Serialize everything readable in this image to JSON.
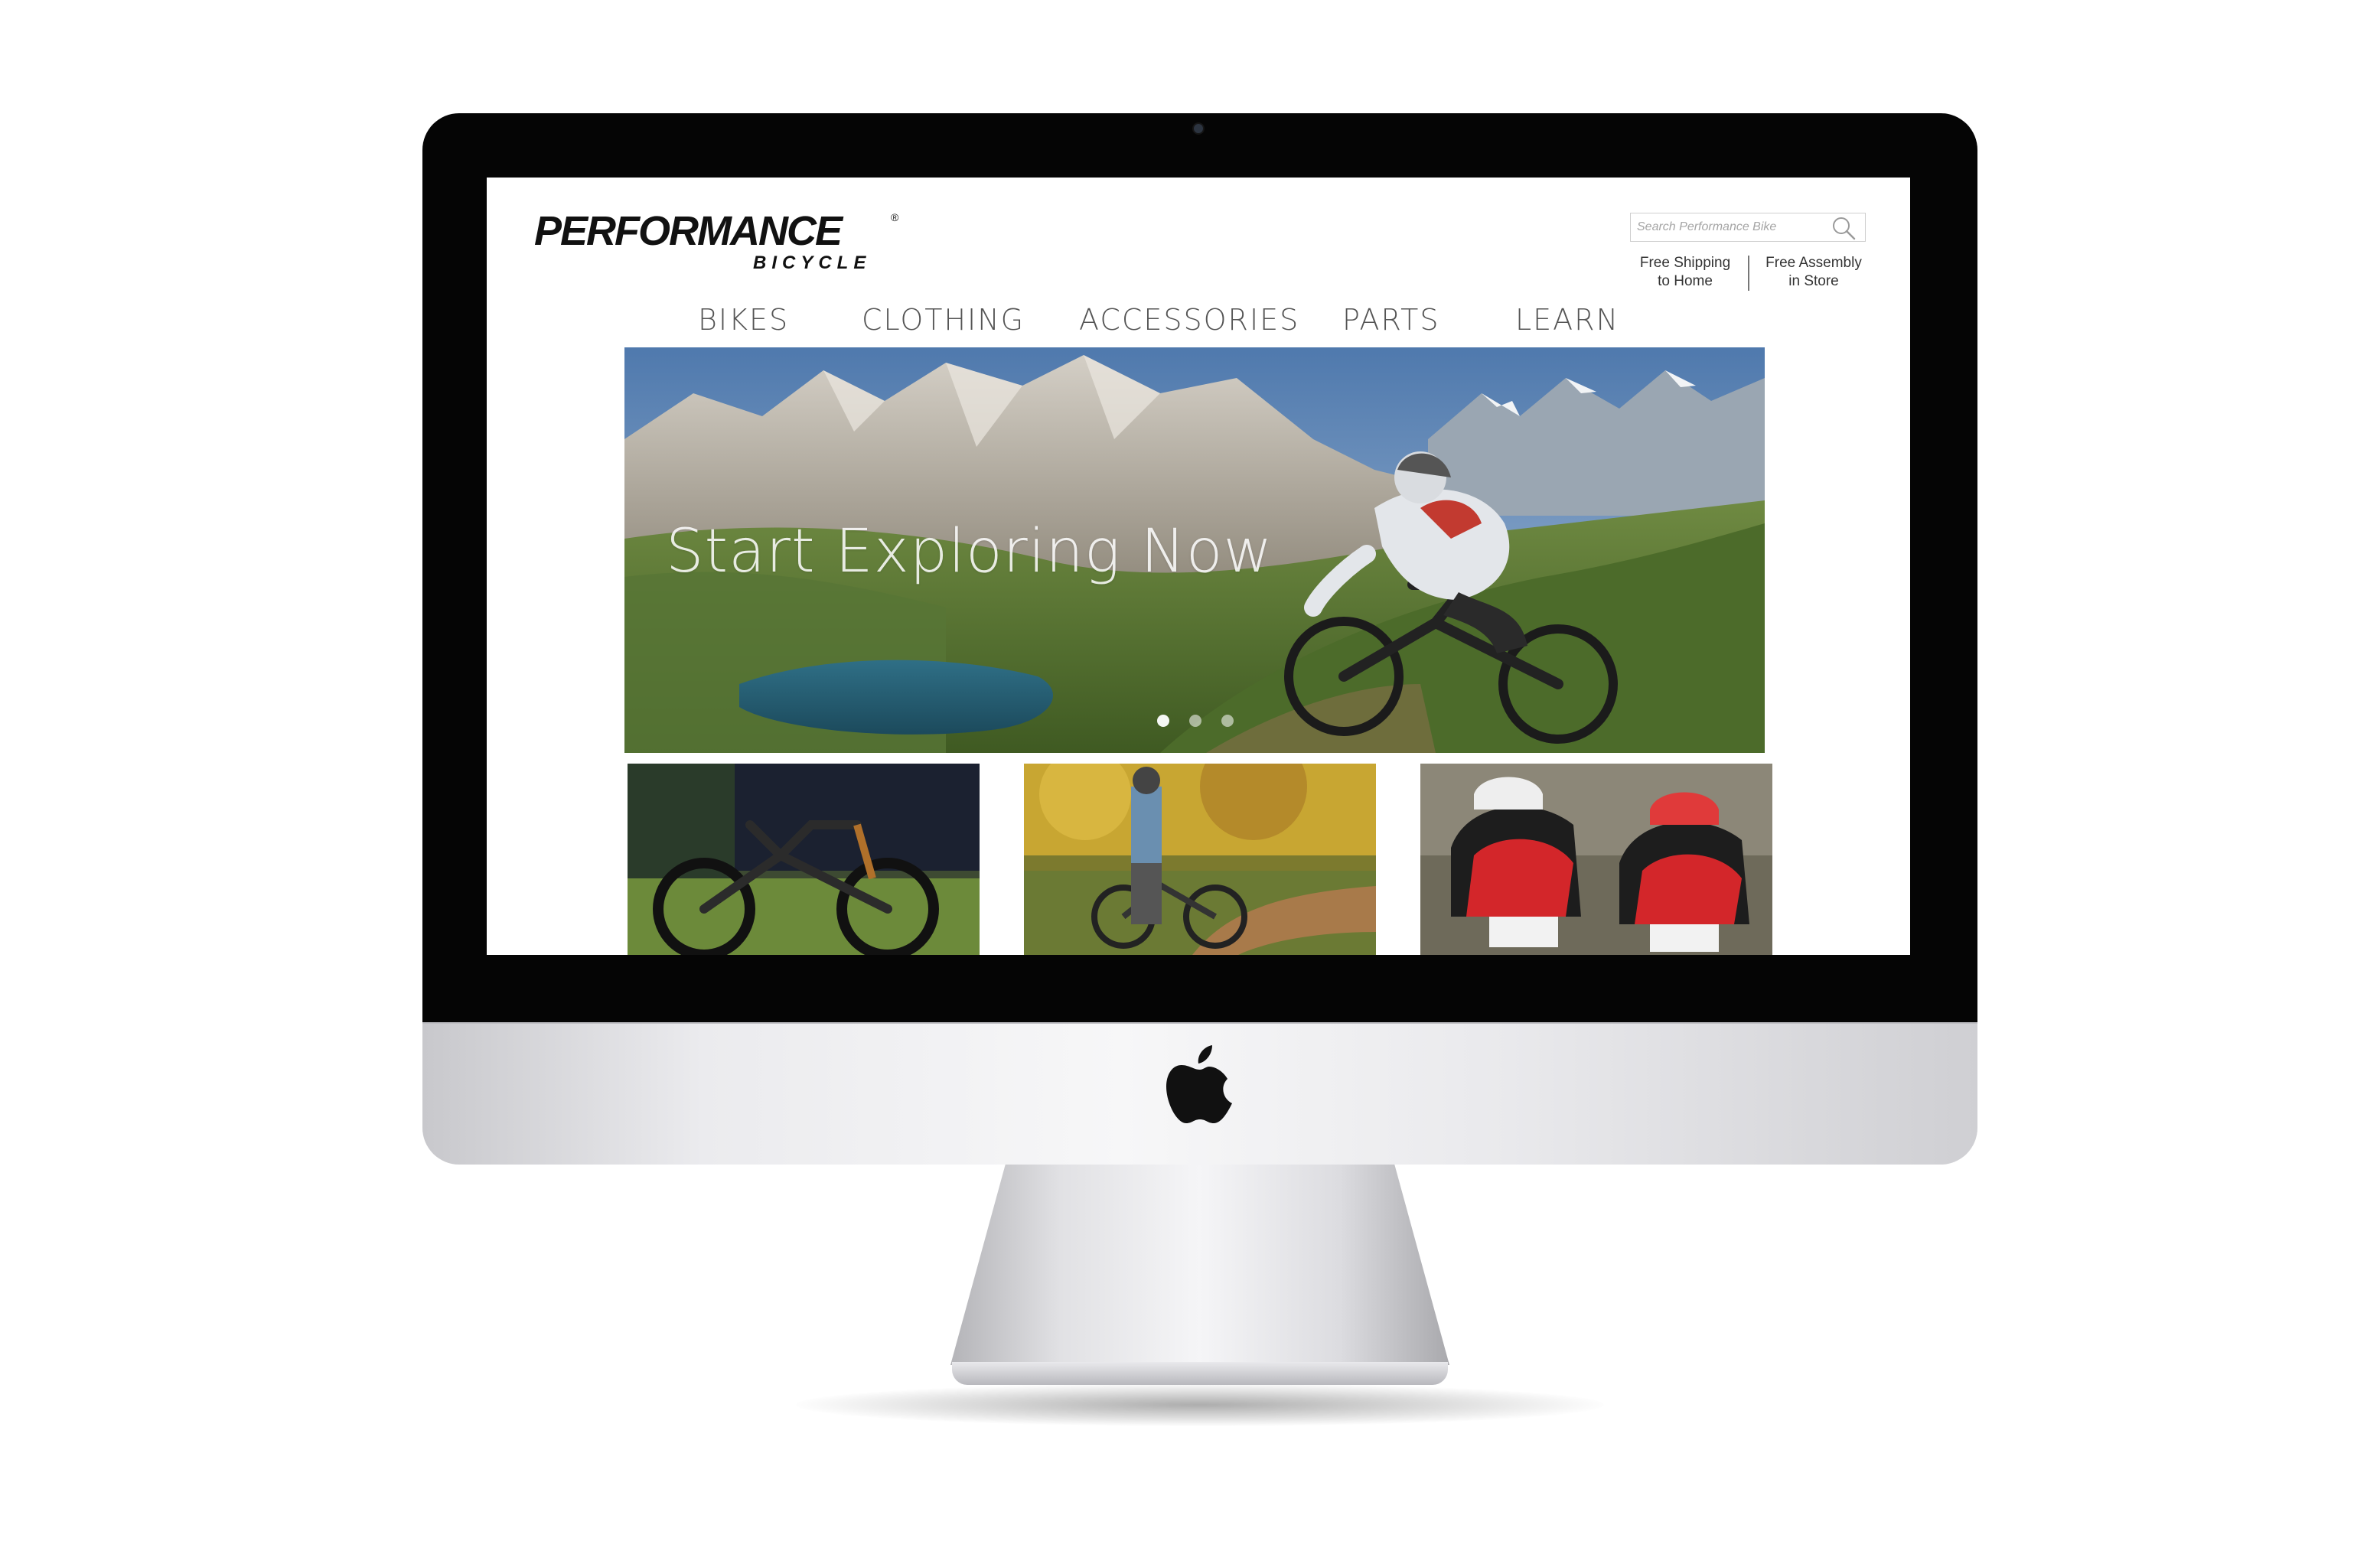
{
  "brand": {
    "name": "PERFORMANCE",
    "sub": "BICYCLE",
    "registered_mark": "®"
  },
  "search": {
    "placeholder": "Search Performance Bike"
  },
  "promos": {
    "shipping_line1": "Free Shipping",
    "shipping_line2": "to Home",
    "assembly_line1": "Free Assembly",
    "assembly_line2": "in Store"
  },
  "nav": {
    "items": [
      {
        "label": "BIKES"
      },
      {
        "label": "CLOTHING"
      },
      {
        "label": "ACCESSORIES"
      },
      {
        "label": "PARTS"
      },
      {
        "label": "LEARN"
      }
    ]
  },
  "hero": {
    "title": "Start Exploring Now",
    "slide_count": 3,
    "active_slide": 1
  },
  "tiles": [
    {
      "icon": "bike-display-photo"
    },
    {
      "icon": "trail-rider-photo"
    },
    {
      "icon": "racing-cyclists-photo"
    }
  ],
  "colors": {
    "bezel": "#050505",
    "chin": "#ebebee",
    "nav_text": "#555555",
    "page_bg": "#ffffff"
  }
}
